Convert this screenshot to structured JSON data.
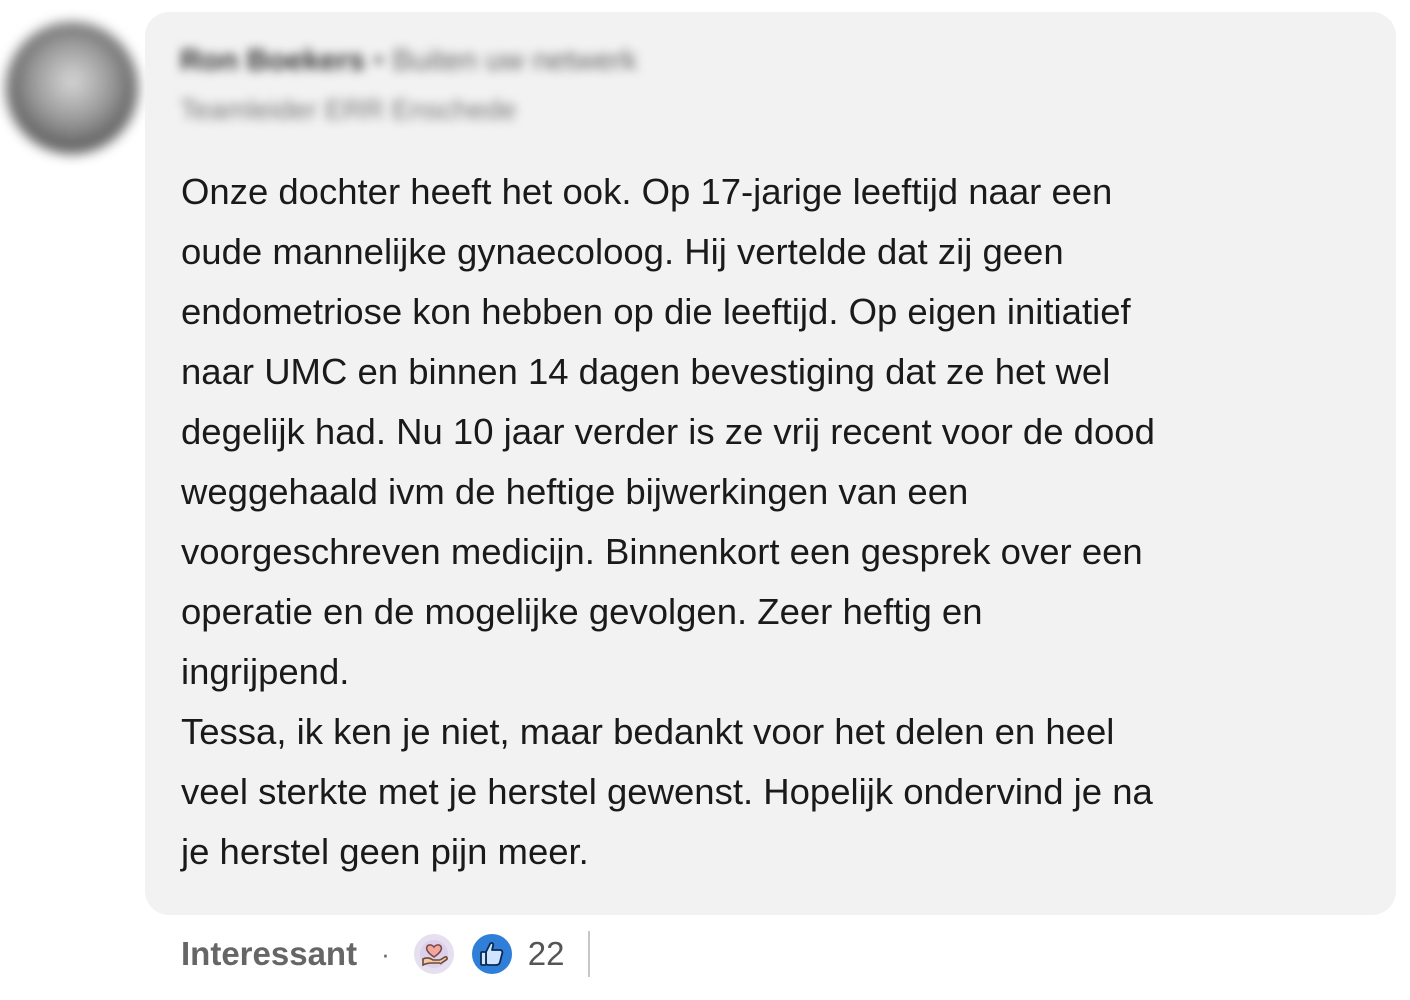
{
  "comment": {
    "author": {
      "name": "Ron Boekers",
      "separator": "•",
      "network": "Buiten uw netwerk",
      "title": "Teamleider ERR Enschede"
    },
    "lines": [
      "Onze dochter heeft het ook. Op 17-jarige leeftijd naar een",
      "oude mannelijke gynaecoloog. Hij vertelde dat zij geen",
      "endometriose kon hebben op die leeftijd. Op eigen initiatief",
      "naar UMC en binnen 14 dagen bevestiging dat ze het wel",
      "degelijk had. Nu 10 jaar verder is ze vrij recent voor de dood",
      "weggehaald ivm de heftige bijwerkingen van een",
      "voorgeschreven medicijn. Binnenkort een gesprek over een",
      "operatie en de mogelijke gevolgen. Zeer heftig en",
      "ingrijpend.",
      "Tessa, ik ken je niet, maar bedankt voor het delen en heel",
      "veel sterkte met je herstel gewenst. Hopelijk ondervind je na",
      "je herstel geen pijn meer."
    ]
  },
  "actions": {
    "react_label": "Interessant",
    "dot": "·",
    "reactions": [
      "insightful-icon",
      "like-icon"
    ],
    "reaction_count": "22"
  },
  "colors": {
    "bubble": "#f2f2f2",
    "like_blue": "#2f7fd8",
    "text": "#1a1a1a",
    "muted": "#666666"
  }
}
